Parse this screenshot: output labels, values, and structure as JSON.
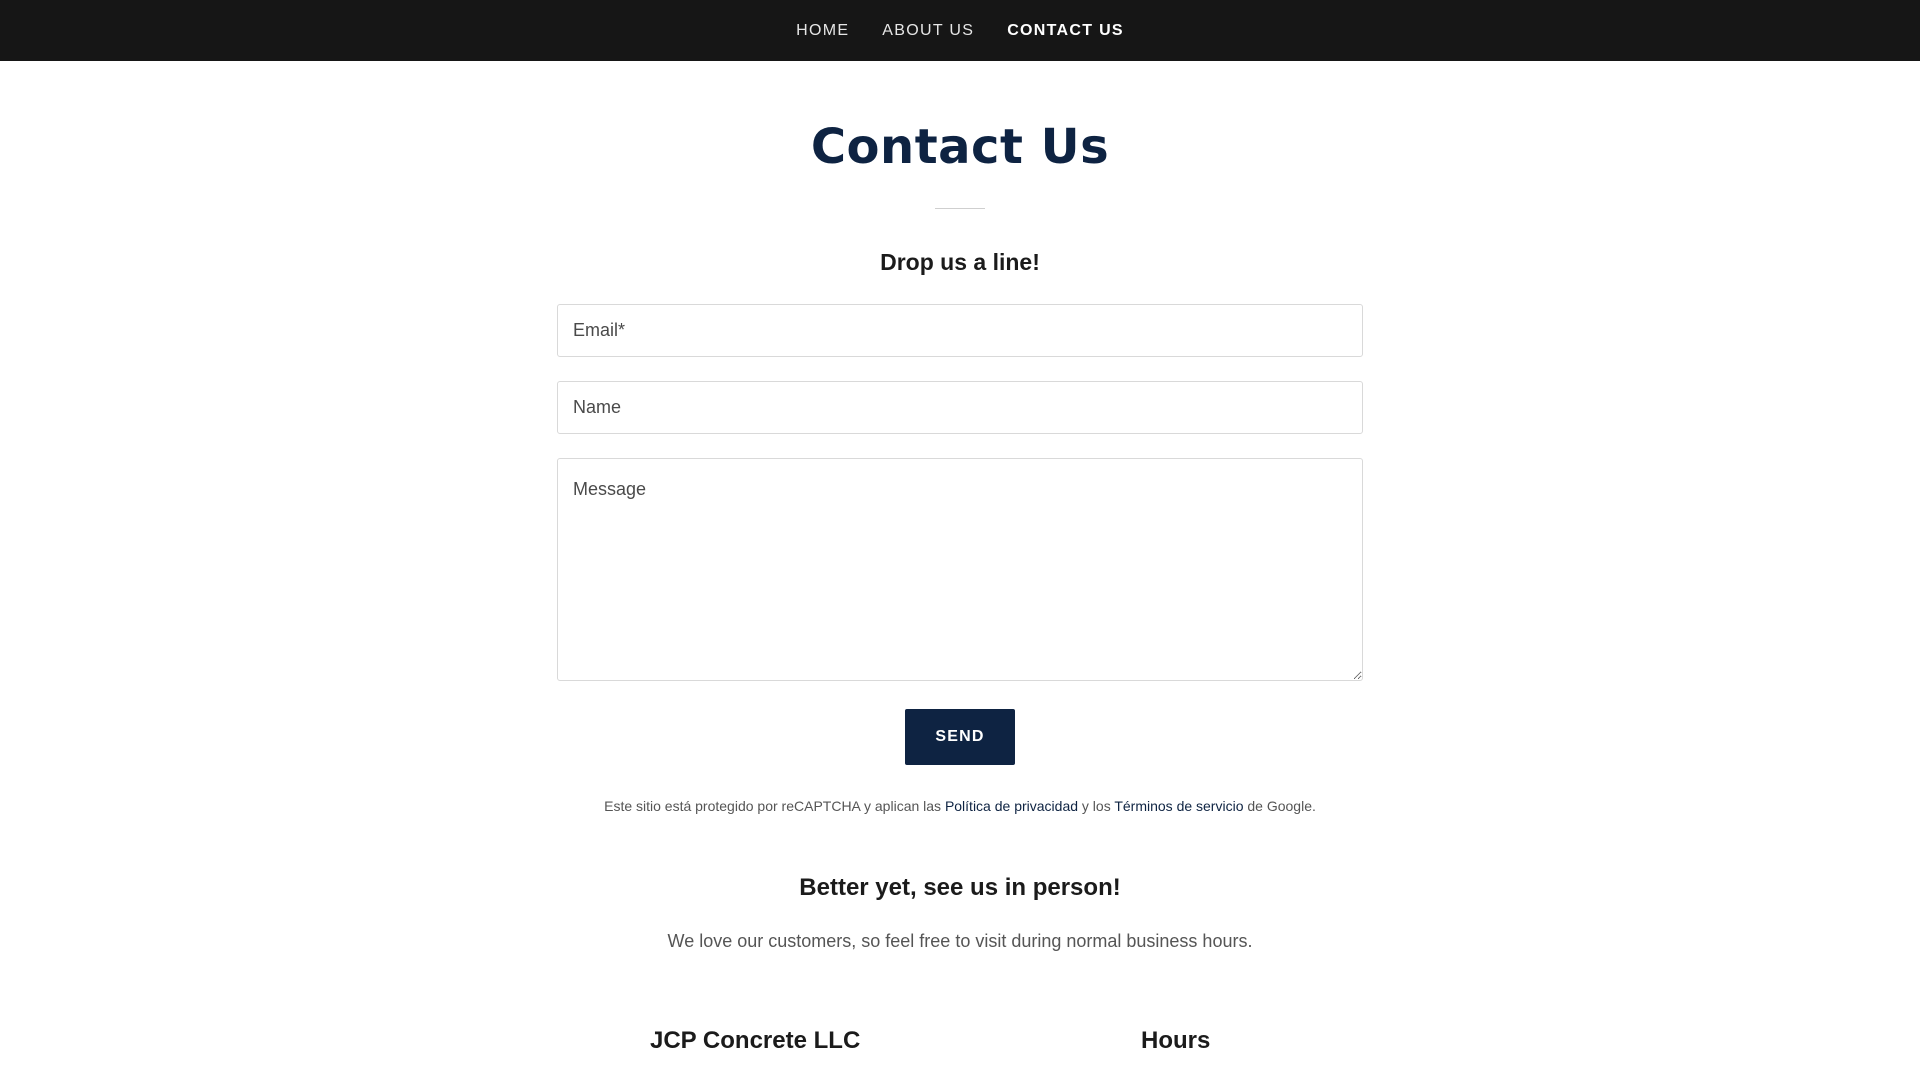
{
  "nav": {
    "items": [
      {
        "label": "HOME",
        "active": false
      },
      {
        "label": "ABOUT US",
        "active": false
      },
      {
        "label": "CONTACT US",
        "active": true
      }
    ]
  },
  "header": {
    "title": "Contact Us",
    "subtitle": "Drop us a line!"
  },
  "form": {
    "email_placeholder": "Email*",
    "name_placeholder": "Name",
    "message_placeholder": "Message",
    "send_label": "SEND"
  },
  "recaptcha": {
    "text_before": "Este sitio está protegido por reCAPTCHA y aplican las ",
    "privacy_label": "Política de privacidad",
    "text_middle": " y los ",
    "terms_label": "Términos de servicio",
    "text_after": " de Google."
  },
  "visit": {
    "heading": "Better yet, see us in person!",
    "text": "We love our customers, so feel free to visit during normal business hours."
  },
  "footer": {
    "company_name": "JCP Concrete LLC",
    "hours_heading": "Hours"
  },
  "colors": {
    "navbar_bg": "#161616",
    "brand_navy": "#0e2342",
    "page_bg": "#ffffff"
  }
}
